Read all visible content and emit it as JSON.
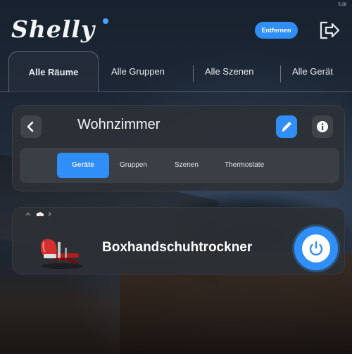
{
  "status_bar": {
    "text": "5:28"
  },
  "header": {
    "logo": "Shelly",
    "button_label": "Entfernen",
    "logout_icon": "logout-icon"
  },
  "tabs": [
    {
      "label": "Alle Räume",
      "active": true
    },
    {
      "label": "Alle Gruppen",
      "active": false
    },
    {
      "label": "Alle Szenen",
      "active": false
    },
    {
      "label": "Alle Gerät",
      "active": false
    }
  ],
  "room": {
    "title": "Wohnzimmer",
    "back_icon": "chevron-left-icon",
    "edit_icon": "pencil-icon",
    "info_icon": "info-icon",
    "sub_tabs": [
      {
        "label": "Geräte",
        "active": true
      },
      {
        "label": "Gruppen",
        "active": false
      },
      {
        "label": "Szenen",
        "active": false
      },
      {
        "label": "Thermostate",
        "active": false
      }
    ]
  },
  "device": {
    "name": "Boxhandschuhtrockner",
    "image_icon": "boxing-glove-dryer-image",
    "indicator_icons": [
      "wifi-icon",
      "cloud-icon",
      "bluetooth-icon"
    ],
    "power_icon": "power-icon",
    "state": "on"
  },
  "colors": {
    "accent": "#2f8ff6",
    "card_bg": "#2c3036",
    "text": "#ffffff"
  }
}
